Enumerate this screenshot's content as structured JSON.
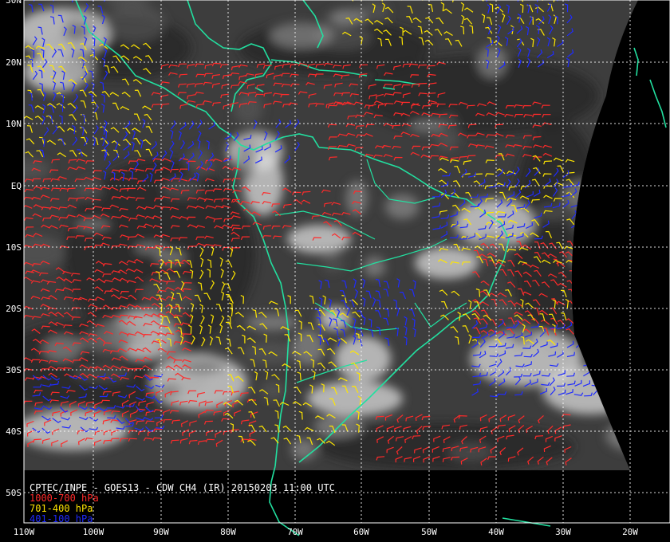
{
  "map": {
    "caption": "CPTEC/INPE - GOES13 - CDW CH4 (IR) 20150203 11:00 UTC",
    "lat_labels": [
      "30N",
      "20N",
      "10N",
      "EQ",
      "10S",
      "20S",
      "30S",
      "40S",
      "50S"
    ],
    "lon_labels": [
      "110W",
      "100W",
      "90W",
      "80W",
      "70W",
      "60W",
      "50W",
      "40W",
      "30W",
      "20W"
    ]
  },
  "legend": [
    {
      "label": "1000-700 hPa",
      "color": "#ff2a2a"
    },
    {
      "label": "701-400 hPa",
      "color": "#ffe600"
    },
    {
      "label": "401-100 hPa",
      "color": "#1f2bff"
    }
  ],
  "colors": {
    "background": "#000000",
    "coastline": "#22e0a0",
    "grid": "#ffffff",
    "cloud_bright": "#f0f0f0",
    "cloud_dark": "#3a3a3a"
  },
  "wind_layers": [
    {
      "name": "low",
      "color": "#ff2a2a"
    },
    {
      "name": "mid",
      "color": "#ffe600"
    },
    {
      "name": "high",
      "color": "#1f2bff"
    }
  ]
}
